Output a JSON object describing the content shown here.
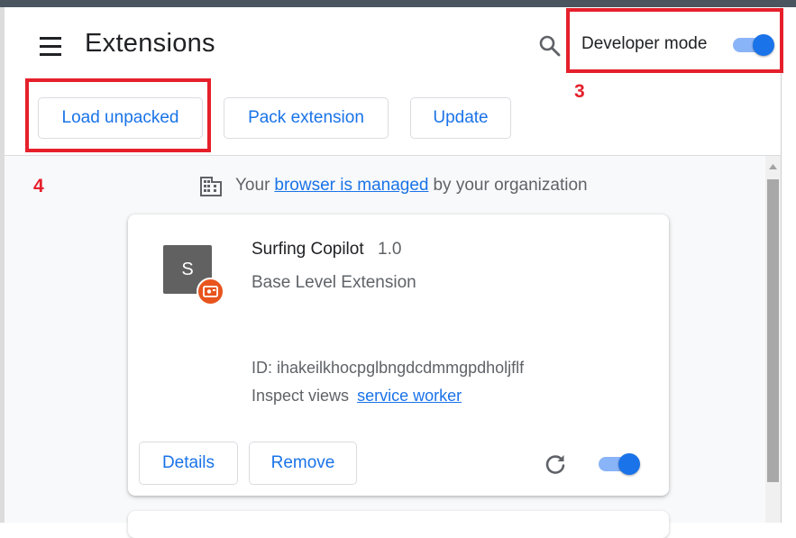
{
  "header": {
    "title": "Extensions",
    "developer_mode_label": "Developer mode",
    "developer_mode_on": true
  },
  "actions": {
    "load_unpacked": "Load unpacked",
    "pack_extension": "Pack extension",
    "update": "Update"
  },
  "annotations": {
    "label_3": "3",
    "label_4": "4",
    "color": "#e5202b"
  },
  "managed_notice": {
    "prefix": "Your",
    "link": "browser is managed",
    "suffix": "by your organization"
  },
  "extension": {
    "icon_letter": "S",
    "name": "Surfing Copilot",
    "version": "1.0",
    "description": "Base Level Extension",
    "id_line": "ID: ihakeilkhocpglbngdcdmmgpdholjflf",
    "inspect_label": "Inspect views",
    "inspect_link": "service worker",
    "details_label": "Details",
    "remove_label": "Remove",
    "enabled": true
  },
  "colors": {
    "accent": "#1a73e8",
    "toggle_track": "#8ab4f8",
    "badge": "#e8541e"
  }
}
